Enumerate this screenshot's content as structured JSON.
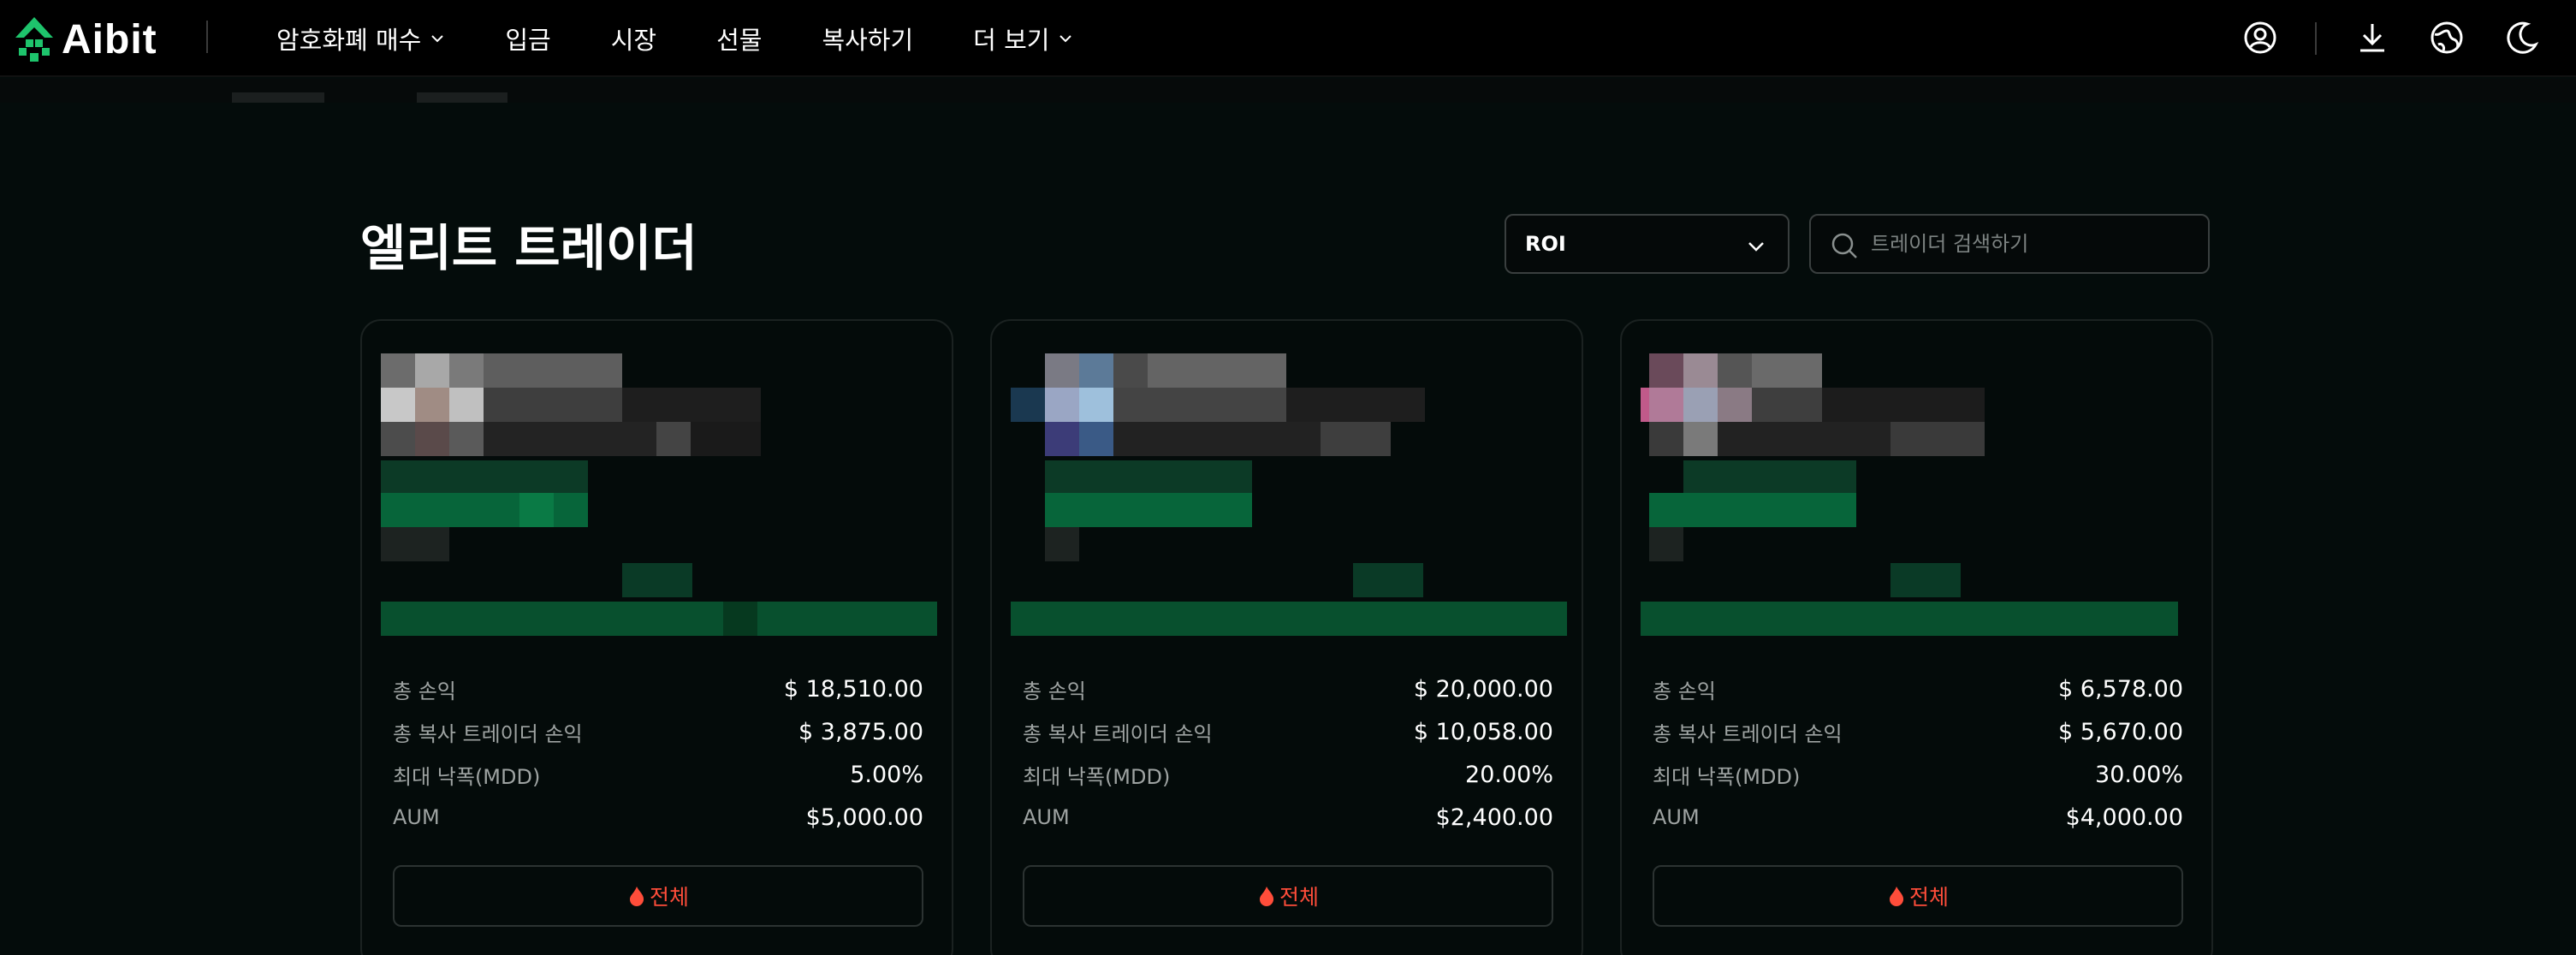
{
  "brand": {
    "name": "Aibit",
    "accent": "#1ec46c"
  },
  "nav": {
    "items": [
      {
        "label": "암호화폐 매수",
        "has_dropdown": true
      },
      {
        "label": "입금",
        "has_dropdown": false
      },
      {
        "label": "시장",
        "has_dropdown": false
      },
      {
        "label": "선물",
        "has_dropdown": false
      },
      {
        "label": "복사하기",
        "has_dropdown": false
      },
      {
        "label": "더 보기",
        "has_dropdown": true
      }
    ],
    "icons": [
      "user-profile-icon",
      "download-icon",
      "language-globe-icon",
      "dark-mode-moon-icon"
    ]
  },
  "page": {
    "title": "엘리트 트레이더",
    "sort": {
      "selected": "ROI"
    },
    "search": {
      "placeholder": "트레이더 검색하기"
    }
  },
  "cards": [
    {
      "stats": [
        {
          "label": "총 손익",
          "value": "$ 18,510.00"
        },
        {
          "label": "총 복사 트레이더 손익",
          "value": "$ 3,875.00"
        },
        {
          "label": "최대 낙폭(MDD)",
          "value": "5.00%"
        },
        {
          "label": "AUM",
          "value": "$5,000.00"
        }
      ],
      "button_label": "전체"
    },
    {
      "stats": [
        {
          "label": "총 손익",
          "value": "$ 20,000.00"
        },
        {
          "label": "총 복사 트레이더 손익",
          "value": "$ 10,058.00"
        },
        {
          "label": "최대 낙폭(MDD)",
          "value": "20.00%"
        },
        {
          "label": "AUM",
          "value": "$2,400.00"
        }
      ],
      "button_label": "전체"
    },
    {
      "stats": [
        {
          "label": "총 손익",
          "value": "$ 6,578.00"
        },
        {
          "label": "총 복사 트레이더 손익",
          "value": "$ 5,670.00"
        },
        {
          "label": "최대 낙폭(MDD)",
          "value": "30.00%"
        },
        {
          "label": "AUM",
          "value": "$4,000.00"
        }
      ],
      "button_label": "전체"
    }
  ],
  "colors": {
    "background": "#040c0b",
    "button_text": "#ff4d3a",
    "label_gray": "#9ea3a2"
  }
}
